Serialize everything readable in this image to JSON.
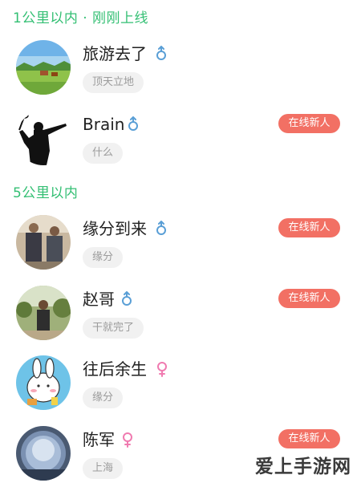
{
  "sections": [
    {
      "title": "1公里以内 · 刚刚上线"
    },
    {
      "title": "5公里以内"
    }
  ],
  "users": [
    {
      "name": "旅游去了",
      "gender": "male",
      "gender_symbol": "♂",
      "tag": "顶天立地",
      "badge": ""
    },
    {
      "name": "Brain",
      "gender": "male",
      "gender_symbol": "♂",
      "tag": "什么",
      "badge": "在线新人"
    },
    {
      "name": "缘分到来",
      "gender": "male",
      "gender_symbol": "♂",
      "tag": "缘分",
      "badge": "在线新人"
    },
    {
      "name": "赵哥",
      "gender": "male",
      "gender_symbol": "♂",
      "tag": "干就完了",
      "badge": "在线新人"
    },
    {
      "name": "往后余生",
      "gender": "female",
      "gender_symbol": "♀",
      "tag": "缘分",
      "badge": ""
    },
    {
      "name": "陈军",
      "gender": "female",
      "gender_symbol": "♀",
      "tag": "上海",
      "badge": "在线新人"
    }
  ],
  "watermark": "爱上手游网",
  "colors": {
    "section_green": "#33bf73",
    "male_blue": "#5a9fd6",
    "female_pink": "#f07bb0",
    "badge_red": "#f27064",
    "tag_bg": "#f1f1f1"
  }
}
